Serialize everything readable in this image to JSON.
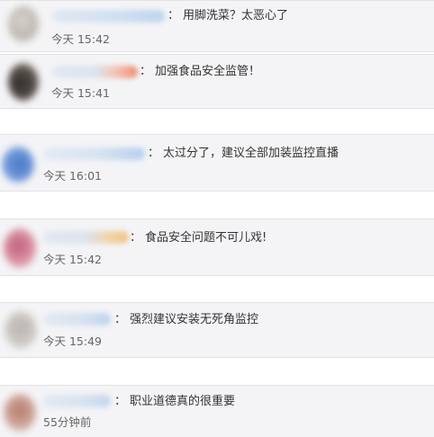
{
  "comments": [
    {
      "text": "用脚洗菜？太恶心了",
      "time": "今天 15:42"
    },
    {
      "text": "加强食品安全监管！",
      "time": "今天 15:41"
    },
    {
      "text": "太过分了，建议全部加装监控直播",
      "time": "今天 16:01"
    },
    {
      "text": "食品安全问题不可儿戏!",
      "time": "今天 15:42"
    },
    {
      "text": "强烈建议安装无死角监控",
      "time": "今天 15:49"
    },
    {
      "text": "职业道德真的很重要",
      "time": "55分钟前"
    }
  ],
  "separator": "："
}
